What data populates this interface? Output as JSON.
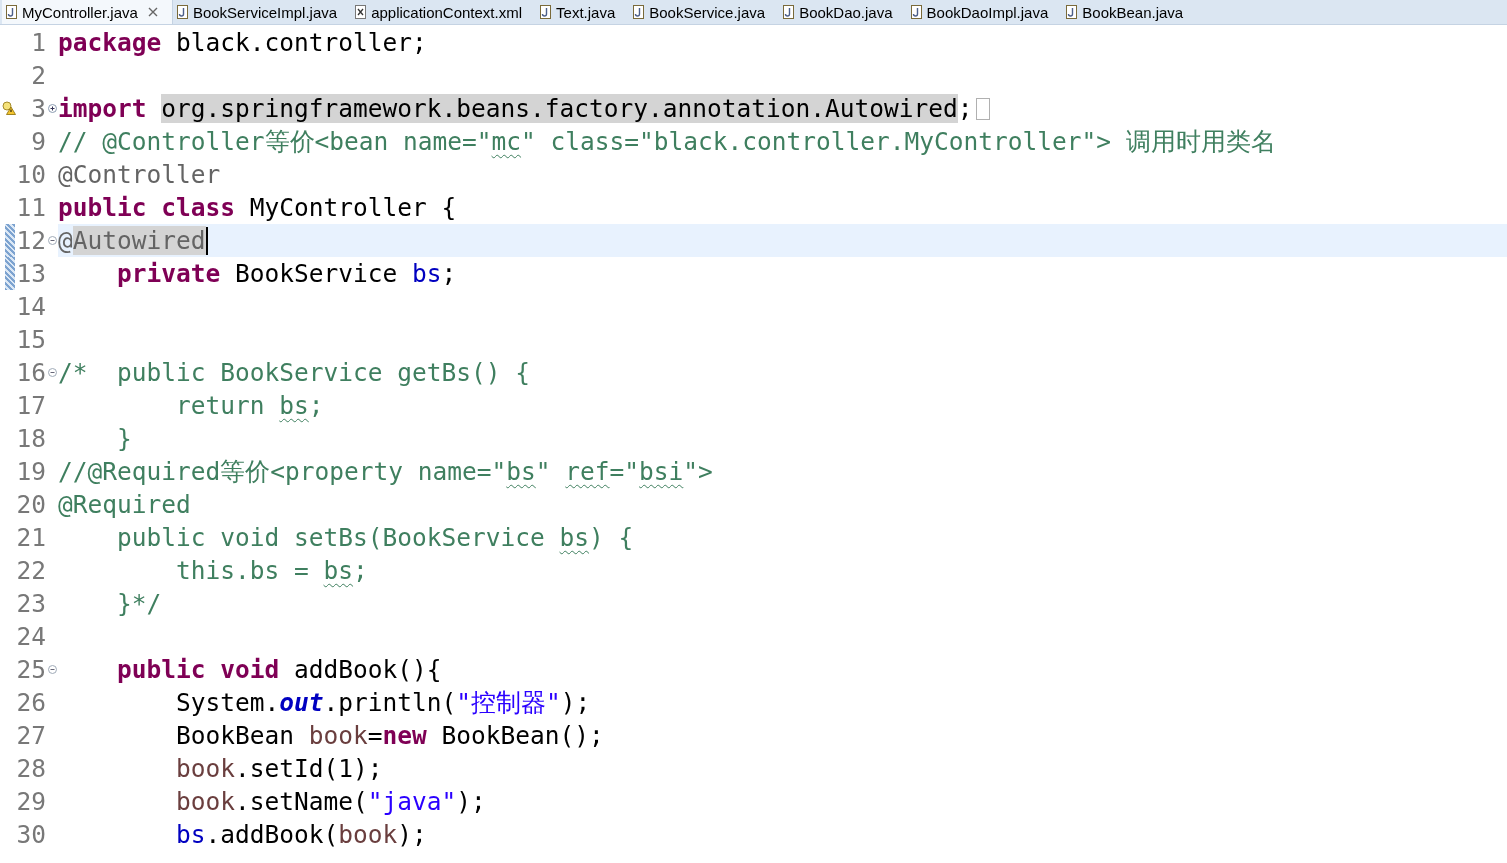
{
  "tabs": [
    {
      "label": "MyController.java",
      "kind": "java",
      "selected": true
    },
    {
      "label": "BookServiceImpl.java",
      "kind": "java",
      "selected": false
    },
    {
      "label": "applicationContext.xml",
      "kind": "xml",
      "selected": false
    },
    {
      "label": "Text.java",
      "kind": "java",
      "selected": false
    },
    {
      "label": "BookService.java",
      "kind": "java",
      "selected": false
    },
    {
      "label": "BookDao.java",
      "kind": "java",
      "selected": false
    },
    {
      "label": "BookDaoImpl.java",
      "kind": "java",
      "selected": false
    },
    {
      "label": "BookBean.java",
      "kind": "java",
      "selected": false
    }
  ],
  "editor": {
    "lines": [
      {
        "number": "1",
        "current": false,
        "changed": false,
        "tokens": [
          {
            "kind": "keyword",
            "text": "package"
          },
          {
            "kind": "plain",
            "text": " black.controller;"
          }
        ]
      },
      {
        "number": "2",
        "current": false,
        "changed": false
      },
      {
        "number": "3",
        "current": false,
        "changed": false,
        "marker": {
          "kind": "warning"
        },
        "fold": {
          "expanded": false
        },
        "tokens": [
          {
            "kind": "keyword",
            "text": "import "
          },
          {
            "kind": "plain",
            "text": "org.springframework.beans.factory.annotation.Autowired",
            "highlighted": true
          },
          {
            "kind": "plain",
            "text": ";"
          }
        ]
      },
      {
        "number": "9",
        "current": false,
        "changed": false,
        "tokens": [
          {
            "kind": "comment",
            "text": "// @Controller等价<bean name=\""
          },
          {
            "kind": "comment",
            "text": "mc",
            "misspelled": true
          },
          {
            "kind": "comment",
            "text": "\" class=\"black.controller.MyController\"> 调用时用类名"
          }
        ]
      },
      {
        "number": "10",
        "current": false,
        "changed": false,
        "tokens": [
          {
            "kind": "annotation",
            "text": "@Controller"
          }
        ]
      },
      {
        "number": "11",
        "current": false,
        "changed": false,
        "tokens": [
          {
            "kind": "keyword",
            "text": "public class"
          },
          {
            "kind": "plain",
            "text": " MyController {"
          }
        ]
      },
      {
        "number": "12",
        "current": true,
        "changed": true,
        "fold": {
          "expanded": true
        },
        "tokens": [
          {
            "kind": "annotation",
            "text": "@"
          },
          {
            "kind": "annotation",
            "text": "Autowired",
            "highlighted": true
          }
        ]
      },
      {
        "number": "13",
        "current": false,
        "changed": true,
        "tokens": [
          {
            "kind": "keyword",
            "text": "    private"
          },
          {
            "kind": "plain",
            "text": " BookService "
          },
          {
            "kind": "field",
            "text": "bs"
          },
          {
            "kind": "plain",
            "text": ";"
          }
        ]
      },
      {
        "number": "14",
        "current": false,
        "changed": false
      },
      {
        "number": "15",
        "current": false,
        "changed": false
      },
      {
        "number": "16",
        "current": false,
        "changed": false,
        "fold": {
          "expanded": true
        },
        "tokens": [
          {
            "kind": "comment",
            "text": "/*  public BookService getBs() {"
          }
        ]
      },
      {
        "number": "17",
        "current": false,
        "changed": false,
        "tokens": [
          {
            "kind": "comment",
            "text": "        return "
          },
          {
            "kind": "comment",
            "text": "bs",
            "misspelled": true
          },
          {
            "kind": "comment",
            "text": ";"
          }
        ]
      },
      {
        "number": "18",
        "current": false,
        "changed": false,
        "tokens": [
          {
            "kind": "comment",
            "text": "    }"
          }
        ]
      },
      {
        "number": "19",
        "current": false,
        "changed": false,
        "tokens": [
          {
            "kind": "comment",
            "text": "//@Required等价<property name=\""
          },
          {
            "kind": "comment",
            "text": "bs",
            "misspelled": true
          },
          {
            "kind": "comment",
            "text": "\" "
          },
          {
            "kind": "comment",
            "text": "ref",
            "misspelled": true
          },
          {
            "kind": "comment",
            "text": "=\""
          },
          {
            "kind": "comment",
            "text": "bsi",
            "misspelled": true
          },
          {
            "kind": "comment",
            "text": "\">"
          }
        ]
      },
      {
        "number": "20",
        "current": false,
        "changed": false,
        "tokens": [
          {
            "kind": "comment",
            "text": "@Required"
          }
        ]
      },
      {
        "number": "21",
        "current": false,
        "changed": false,
        "tokens": [
          {
            "kind": "comment",
            "text": "    public void setBs(BookService "
          },
          {
            "kind": "comment",
            "text": "bs",
            "misspelled": true
          },
          {
            "kind": "comment",
            "text": ") {"
          }
        ]
      },
      {
        "number": "22",
        "current": false,
        "changed": false,
        "tokens": [
          {
            "kind": "comment",
            "text": "        this.bs = "
          },
          {
            "kind": "comment",
            "text": "bs",
            "misspelled": true
          },
          {
            "kind": "comment",
            "text": ";"
          }
        ]
      },
      {
        "number": "23",
        "current": false,
        "changed": false,
        "tokens": [
          {
            "kind": "comment",
            "text": "    }*/"
          }
        ]
      },
      {
        "number": "24",
        "current": false,
        "changed": false
      },
      {
        "number": "25",
        "current": false,
        "changed": false,
        "fold": {
          "expanded": true
        },
        "tokens": [
          {
            "kind": "keyword",
            "text": "    public void"
          },
          {
            "kind": "plain",
            "text": " addBook(){"
          }
        ]
      },
      {
        "number": "26",
        "current": false,
        "changed": false,
        "tokens": [
          {
            "kind": "plain",
            "text": "        System."
          },
          {
            "kind": "static",
            "text": "out"
          },
          {
            "kind": "plain",
            "text": ".println("
          },
          {
            "kind": "string",
            "text": "\"控制器\""
          },
          {
            "kind": "plain",
            "text": ");"
          }
        ]
      },
      {
        "number": "27",
        "current": false,
        "changed": false,
        "tokens": [
          {
            "kind": "plain",
            "text": "        BookBean "
          },
          {
            "kind": "local",
            "text": "book"
          },
          {
            "kind": "plain",
            "text": "="
          },
          {
            "kind": "keyword",
            "text": "new"
          },
          {
            "kind": "plain",
            "text": " BookBean();"
          }
        ]
      },
      {
        "number": "28",
        "current": false,
        "changed": false,
        "tokens": [
          {
            "kind": "local",
            "text": "        book"
          },
          {
            "kind": "plain",
            "text": ".setId(1);"
          }
        ]
      },
      {
        "number": "29",
        "current": false,
        "changed": false,
        "tokens": [
          {
            "kind": "local",
            "text": "        book"
          },
          {
            "kind": "plain",
            "text": ".setName("
          },
          {
            "kind": "string",
            "text": "\"java\""
          },
          {
            "kind": "plain",
            "text": ");"
          }
        ]
      },
      {
        "number": "30",
        "current": false,
        "changed": false,
        "tokens": [
          {
            "kind": "field",
            "text": "        bs"
          },
          {
            "kind": "plain",
            "text": ".addBook("
          },
          {
            "kind": "local",
            "text": "book"
          },
          {
            "kind": "plain",
            "text": ");"
          }
        ]
      }
    ]
  }
}
